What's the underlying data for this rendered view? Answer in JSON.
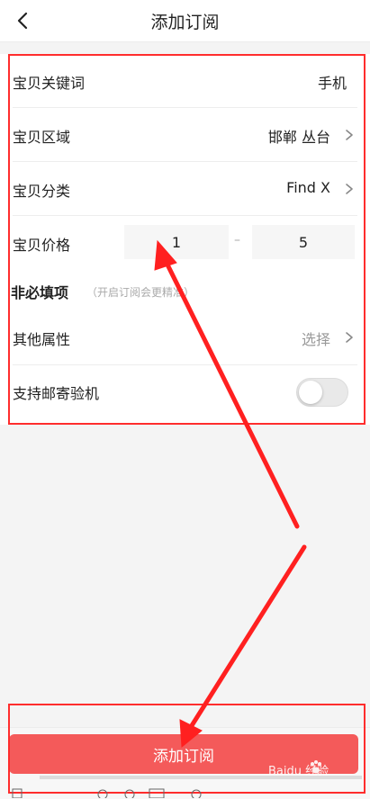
{
  "header": {
    "title": "添加订阅"
  },
  "form": {
    "keyword": {
      "label": "宝贝关键词",
      "value": "手机"
    },
    "region": {
      "label": "宝贝区域",
      "value": "邯郸 丛台"
    },
    "category": {
      "label": "宝贝分类",
      "value": "Find X"
    },
    "price": {
      "label": "宝贝价格",
      "min": "1",
      "max": "5",
      "separator": "–"
    },
    "optional": {
      "title": "非必填项",
      "hint": "（开启订阅会更精准）"
    },
    "other_attrs": {
      "label": "其他属性",
      "value": "选择"
    },
    "trial": {
      "label": "支持邮寄验机",
      "enabled": false
    }
  },
  "actions": {
    "add_label": "添加订阅"
  },
  "watermark": {
    "text": "Baidu 经验"
  },
  "colors": {
    "accent": "#f45a5a",
    "highlight": "#ff2d2d",
    "arrow": "#ff2020"
  },
  "icons": [
    "back-icon",
    "chevron-right-icon",
    "paw-icon"
  ]
}
